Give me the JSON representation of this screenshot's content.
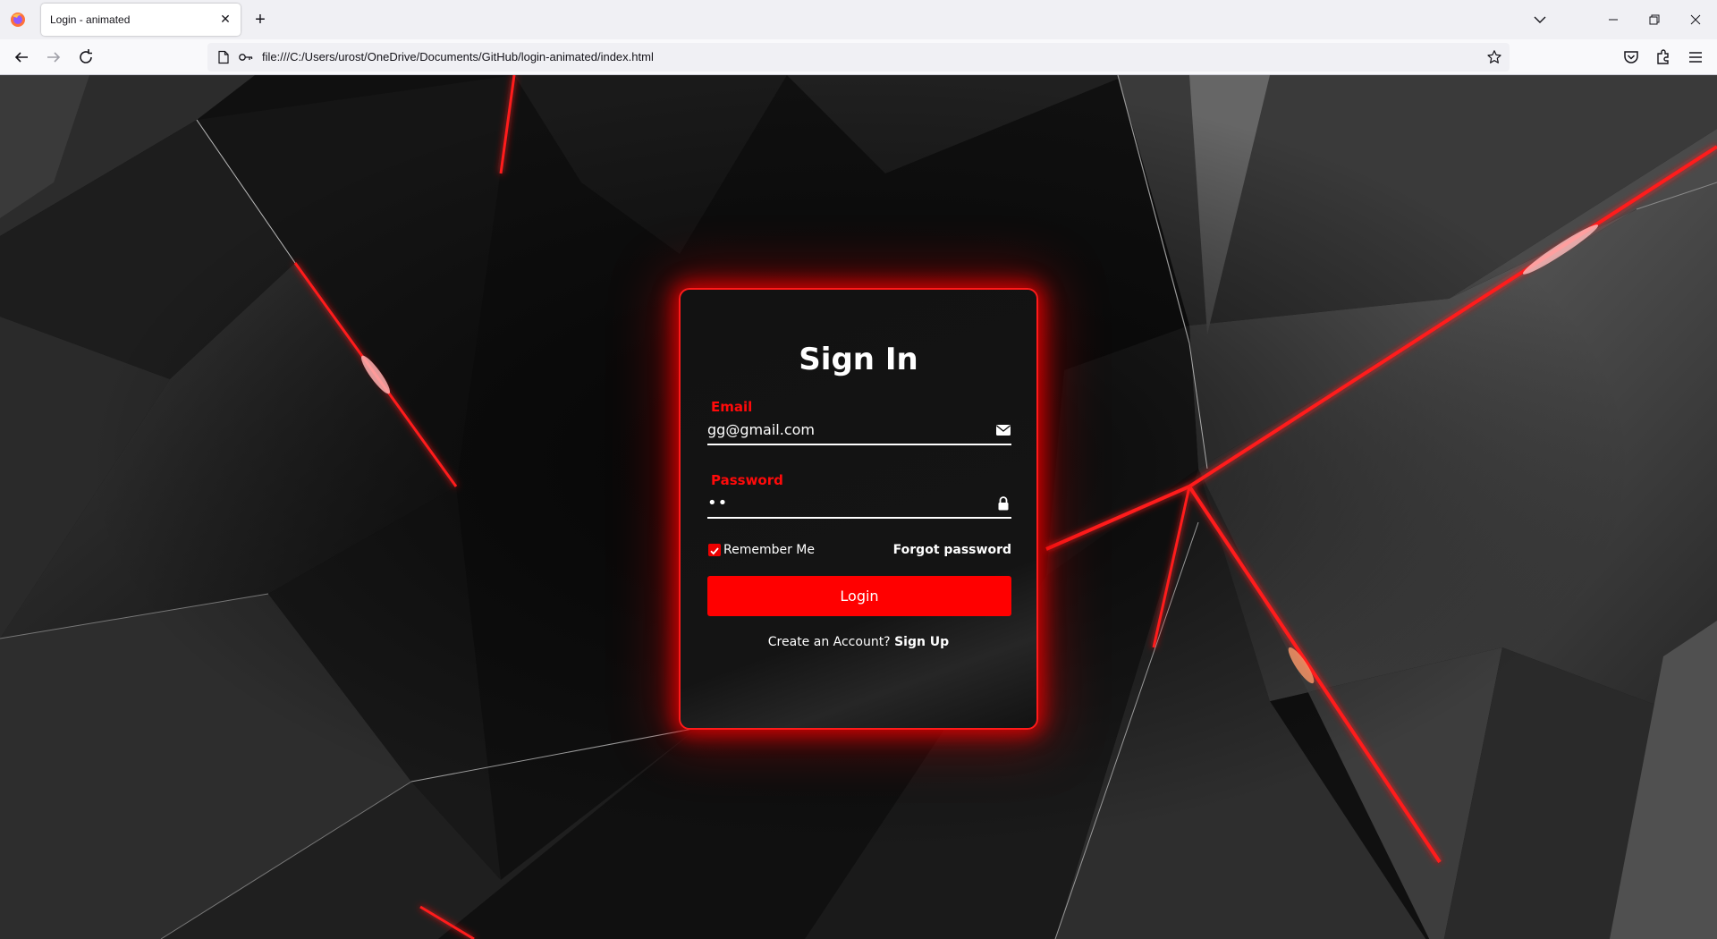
{
  "browser": {
    "tab_title": "Login - animated",
    "tab_close": "✕",
    "new_tab": "+",
    "url": "file:///C:/Users/urost/OneDrive/Documents/GitHub/login-animated/index.html"
  },
  "colors": {
    "accent": "#ff0000",
    "card_border": "#ff1a1a",
    "label": "#ff0a0a",
    "background": "#0c0c0c"
  },
  "login": {
    "title": "Sign In",
    "email_label": "Email",
    "email_value": "gg@gmail.com",
    "password_label": "Password",
    "password_value": "••",
    "remember_label": "Remember Me",
    "remember_checked": true,
    "forgot_label": "Forgot password",
    "login_button": "Login",
    "signup_prompt": "Create an Account?",
    "signup_link": "Sign Up"
  },
  "icons": {
    "email": "envelope-icon",
    "password": "lock-icon"
  }
}
